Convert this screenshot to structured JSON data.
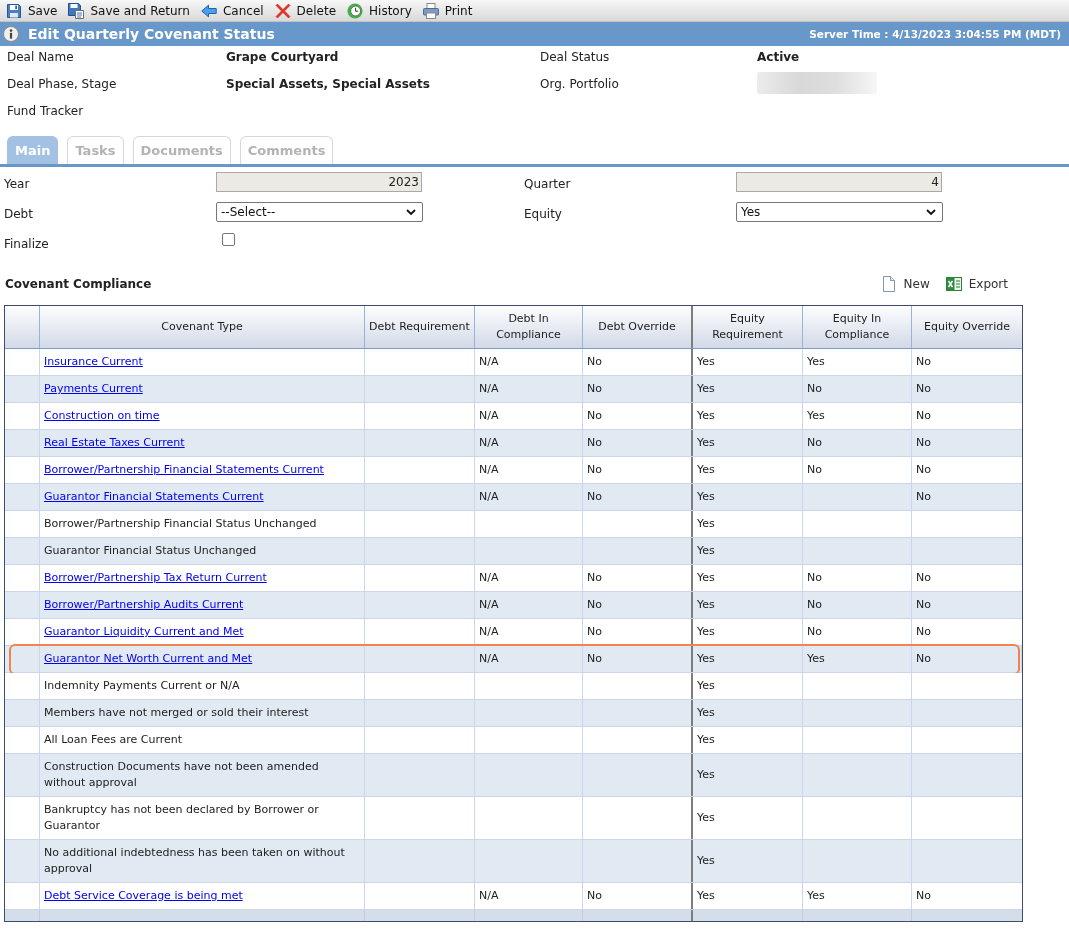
{
  "toolbar": [
    {
      "label": "Save",
      "kind": "save"
    },
    {
      "label": "Save and Return",
      "kind": "save_return"
    },
    {
      "label": "Cancel",
      "kind": "cancel"
    },
    {
      "label": "Delete",
      "kind": "delete"
    },
    {
      "label": "History",
      "kind": "history"
    },
    {
      "label": "Print",
      "kind": "print"
    }
  ],
  "header": {
    "title": "Edit Quarterly Covenant Status",
    "server_time": "Server Time : 4/13/2023 3:04:55 PM (MDT)"
  },
  "deal_info": [
    {
      "label": "Deal Name",
      "value": "Grape Courtyard"
    },
    {
      "label": "Deal Status",
      "value": "Active"
    },
    {
      "label": "Deal Phase, Stage",
      "value": "Special Assets, Special Assets"
    },
    {
      "label": "Org. Portfolio",
      "redacted": true
    },
    {
      "label": "Fund Tracker"
    }
  ],
  "tabs": [
    {
      "label": "Main",
      "selected": true
    },
    {
      "label": "Tasks",
      "selected": false
    },
    {
      "label": "Documents",
      "selected": false
    },
    {
      "label": "Comments",
      "selected": false
    }
  ],
  "form": {
    "fields": [
      {
        "label": "Year",
        "kind": "input",
        "value": "2023",
        "readonly": true
      },
      {
        "label": "Quarter",
        "kind": "input",
        "value": "4",
        "readonly": true
      },
      {
        "label": "Debt",
        "kind": "select",
        "value": "--Select--"
      },
      {
        "label": "Equity",
        "kind": "select",
        "value": "Yes"
      },
      {
        "label": "Finalize",
        "kind": "checkbox",
        "checked": false
      }
    ]
  },
  "covenant_compliance": {
    "title": "Covenant Compliance",
    "actions": [
      {
        "label": "New",
        "kind": "new"
      },
      {
        "label": "Export",
        "kind": "export"
      }
    ],
    "columns": [
      "Covenant Type",
      "Debt Requirement",
      "Debt In Compliance",
      "Debt Override",
      "Equity Requirement",
      "Equity In Compliance",
      "Equity Override"
    ],
    "rows": [
      {
        "covenant": "Insurance Current",
        "kind": "link",
        "debt_in_compliance": "N/A",
        "debt_override": "No",
        "equity_requirement": "Yes",
        "equity_in_compliance": "Yes",
        "equity_override": "No",
        "highlighted": false
      },
      {
        "covenant": "Payments Current",
        "kind": "link",
        "debt_in_compliance": "N/A",
        "debt_override": "No",
        "equity_requirement": "Yes",
        "equity_in_compliance": "No",
        "equity_override": "No",
        "highlighted": false
      },
      {
        "covenant": "Construction on time",
        "kind": "link",
        "debt_in_compliance": "N/A",
        "debt_override": "No",
        "equity_requirement": "Yes",
        "equity_in_compliance": "Yes",
        "equity_override": "No",
        "highlighted": false
      },
      {
        "covenant": "Real Estate Taxes Current",
        "kind": "link",
        "debt_in_compliance": "N/A",
        "debt_override": "No",
        "equity_requirement": "Yes",
        "equity_in_compliance": "No",
        "equity_override": "No",
        "highlighted": false
      },
      {
        "covenant": "Borrower/Partnership Financial Statements Current",
        "kind": "link",
        "debt_in_compliance": "N/A",
        "debt_override": "No",
        "equity_requirement": "Yes",
        "equity_in_compliance": "No",
        "equity_override": "No",
        "highlighted": false
      },
      {
        "covenant": "Guarantor Financial Statements Current",
        "kind": "link",
        "debt_in_compliance": "N/A",
        "debt_override": "No",
        "equity_requirement": "Yes",
        "equity_override": "No",
        "highlighted": false
      },
      {
        "covenant": "Borrower/Partnership Financial Status Unchanged",
        "kind": "text",
        "equity_requirement": "Yes",
        "highlighted": false
      },
      {
        "covenant": "Guarantor Financial Status Unchanged",
        "kind": "text",
        "equity_requirement": "Yes",
        "highlighted": false
      },
      {
        "covenant": "Borrower/Partnership Tax Return Current",
        "kind": "link",
        "debt_in_compliance": "N/A",
        "debt_override": "No",
        "equity_requirement": "Yes",
        "equity_in_compliance": "No",
        "equity_override": "No",
        "highlighted": false
      },
      {
        "covenant": "Borrower/Partnership Audits Current",
        "kind": "link",
        "debt_in_compliance": "N/A",
        "debt_override": "No",
        "equity_requirement": "Yes",
        "equity_in_compliance": "No",
        "equity_override": "No",
        "highlighted": false
      },
      {
        "covenant": "Guarantor Liquidity Current and Met",
        "kind": "link",
        "debt_in_compliance": "N/A",
        "debt_override": "No",
        "equity_requirement": "Yes",
        "equity_in_compliance": "No",
        "equity_override": "No",
        "highlighted": false
      },
      {
        "covenant": "Guarantor Net Worth Current and Met",
        "kind": "link",
        "debt_in_compliance": "N/A",
        "debt_override": "No",
        "equity_requirement": "Yes",
        "equity_in_compliance": "Yes",
        "equity_override": "No",
        "highlighted": true
      },
      {
        "covenant": "Indemnity Payments Current or N/A",
        "kind": "text",
        "equity_requirement": "Yes",
        "highlighted": false
      },
      {
        "covenant": "Members have not merged or sold their interest",
        "kind": "text",
        "equity_requirement": "Yes",
        "highlighted": false
      },
      {
        "covenant": "All Loan Fees are Current",
        "kind": "text",
        "equity_requirement": "Yes",
        "highlighted": false
      },
      {
        "covenant": "Construction Documents have not been amended without approval",
        "kind": "text",
        "equity_requirement": "Yes",
        "highlighted": false
      },
      {
        "covenant": "Bankruptcy has not been declared by Borrower or Guarantor",
        "kind": "text",
        "equity_requirement": "Yes",
        "highlighted": false
      },
      {
        "covenant": "No additional indebtedness has been taken on without approval",
        "kind": "text",
        "equity_requirement": "Yes",
        "highlighted": false
      },
      {
        "covenant": "Debt Service Coverage is being met",
        "kind": "link",
        "debt_in_compliance": "N/A",
        "debt_override": "No",
        "equity_requirement": "Yes",
        "equity_in_compliance": "Yes",
        "equity_override": "No",
        "highlighted": false
      }
    ]
  }
}
